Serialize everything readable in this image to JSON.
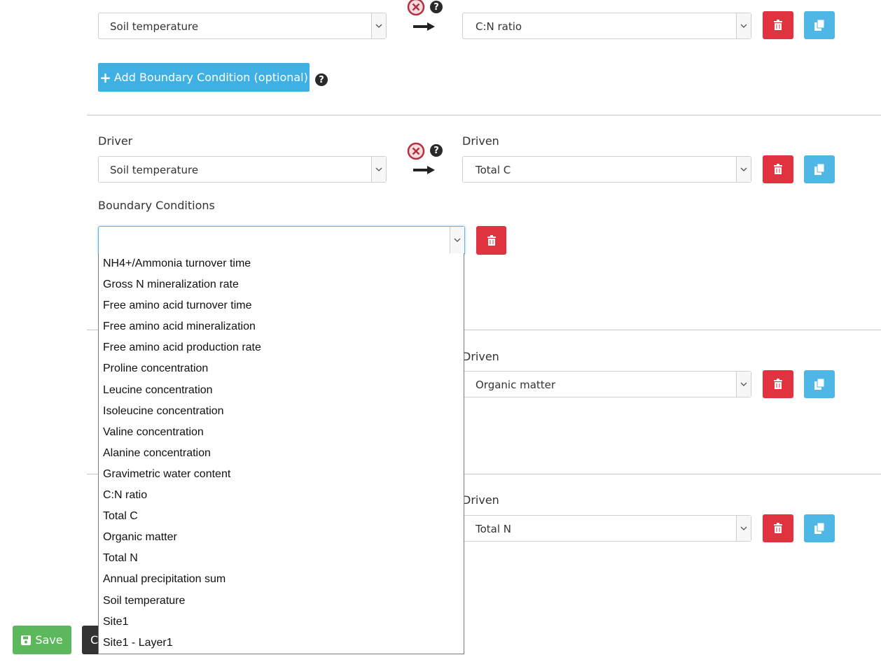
{
  "rows": [
    {
      "driver_value": "Soil temperature",
      "driven_value": "C:N ratio"
    },
    {
      "driver_label": "Driver",
      "driven_label": "Driven",
      "driver_value": "Soil temperature",
      "driven_value": "Total C",
      "boundary_label": "Boundary Conditions",
      "boundary_value": ""
    },
    {
      "driven_label": "Driven",
      "driven_value": "Organic matter"
    },
    {
      "driven_label": "Driven",
      "driven_value": "Total N"
    }
  ],
  "add_boundary_label": "Add Boundary Condition (optional)",
  "help_glyph": "?",
  "dropdown_options": [
    "NH4+/Ammonia turnover time",
    "Gross N mineralization rate",
    "Free amino acid turnover time",
    "Free amino acid mineralization",
    "Free amino acid production rate",
    "Proline concentration",
    "Leucine concentration",
    "Isoleucine concentration",
    "Valine concentration",
    "Alanine concentration",
    "Gravimetric water content",
    "C:N ratio",
    "Total C",
    "Organic matter",
    "Total N",
    "Annual precipitation sum",
    "Soil temperature",
    "Site1",
    "Site1 - Layer1"
  ],
  "footer": {
    "save_label": "Save",
    "second_button_char": "C"
  },
  "colors": {
    "danger": "#e0323f",
    "info": "#4fb7e6",
    "primary": "#3fb0e3",
    "success": "#5cb85c"
  },
  "icons": [
    "remove-circle-icon",
    "question-icon",
    "arrow-right-icon",
    "trash-icon",
    "copy-icon",
    "plus-icon",
    "chevron-down-icon",
    "floppy-icon"
  ]
}
